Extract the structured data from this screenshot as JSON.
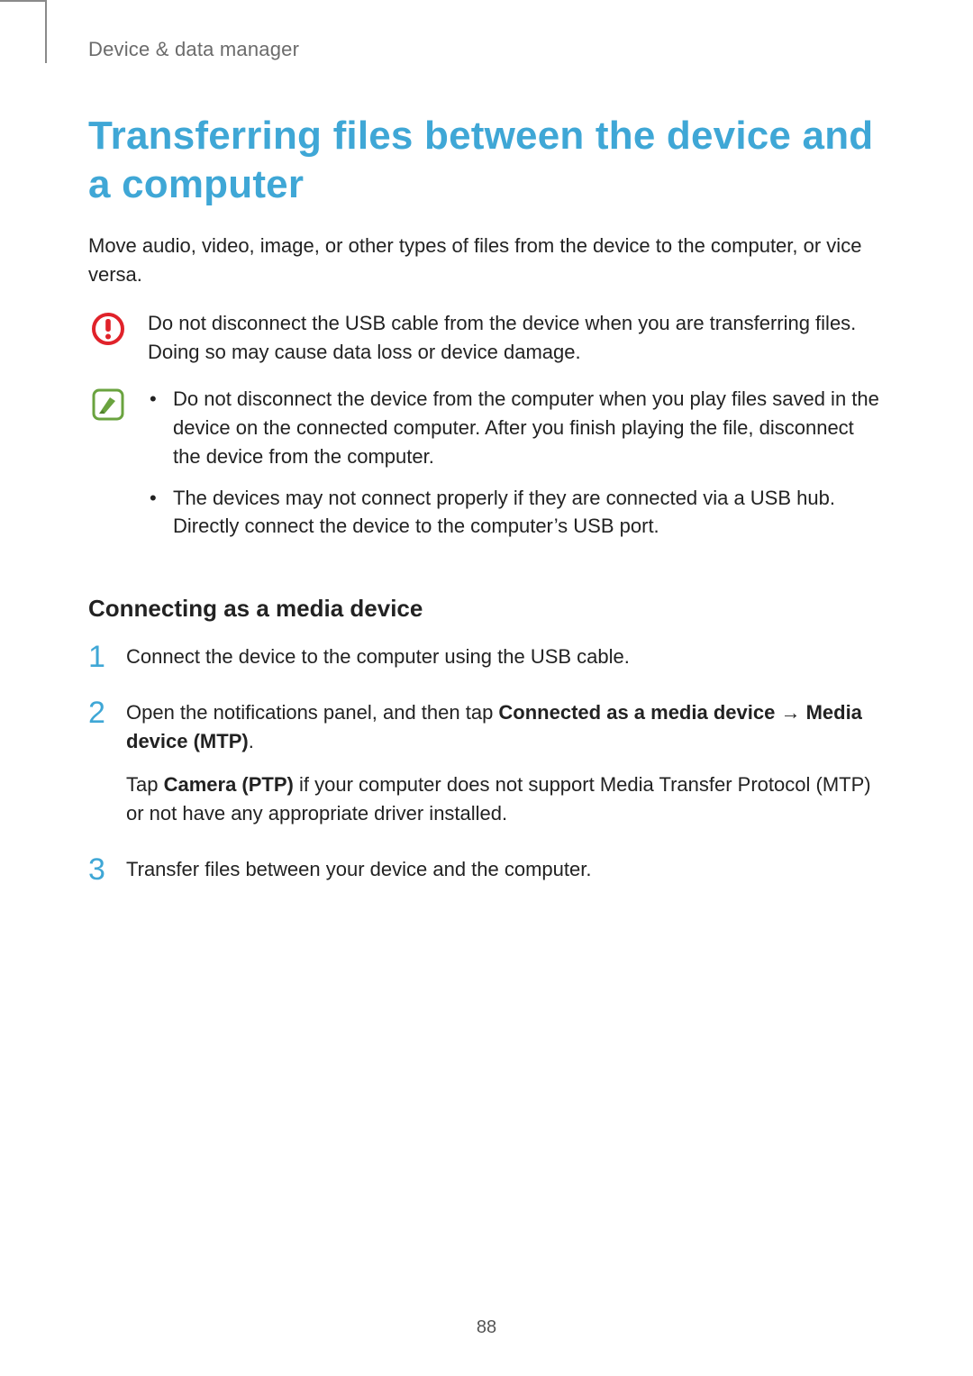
{
  "header": {
    "section": "Device & data manager"
  },
  "title": "Transferring files between the device and a computer",
  "intro": "Move audio, video, image, or other types of files from the device to the computer, or vice versa.",
  "callout_warning": {
    "icon": "caution-icon",
    "text": "Do not disconnect the USB cable from the device when you are transferring files. Doing so may cause data loss or device damage."
  },
  "callout_note": {
    "icon": "note-icon",
    "bullets": [
      "Do not disconnect the device from the computer when you play files saved in the device on the connected computer. After you finish playing the file, disconnect the device from the computer.",
      "The devices may not connect properly if they are connected via a USB hub. Directly connect the device to the computer’s USB port."
    ]
  },
  "subheading": "Connecting as a media device",
  "steps": {
    "nums": [
      "1",
      "2",
      "3"
    ],
    "s1": "Connect the device to the computer using the USB cable.",
    "s2_pre": "Open the notifications panel, and then tap ",
    "s2_b1": "Connected as a media device",
    "s2_arrow": " → ",
    "s2_b2": "Media device (MTP)",
    "s2_post": ".",
    "s2p2_pre": "Tap ",
    "s2p2_b": "Camera (PTP)",
    "s2p2_post": " if your computer does not support Media Transfer Protocol (MTP) or not have any appropriate driver installed.",
    "s3": "Transfer files between your device and the computer."
  },
  "page_number": "88"
}
